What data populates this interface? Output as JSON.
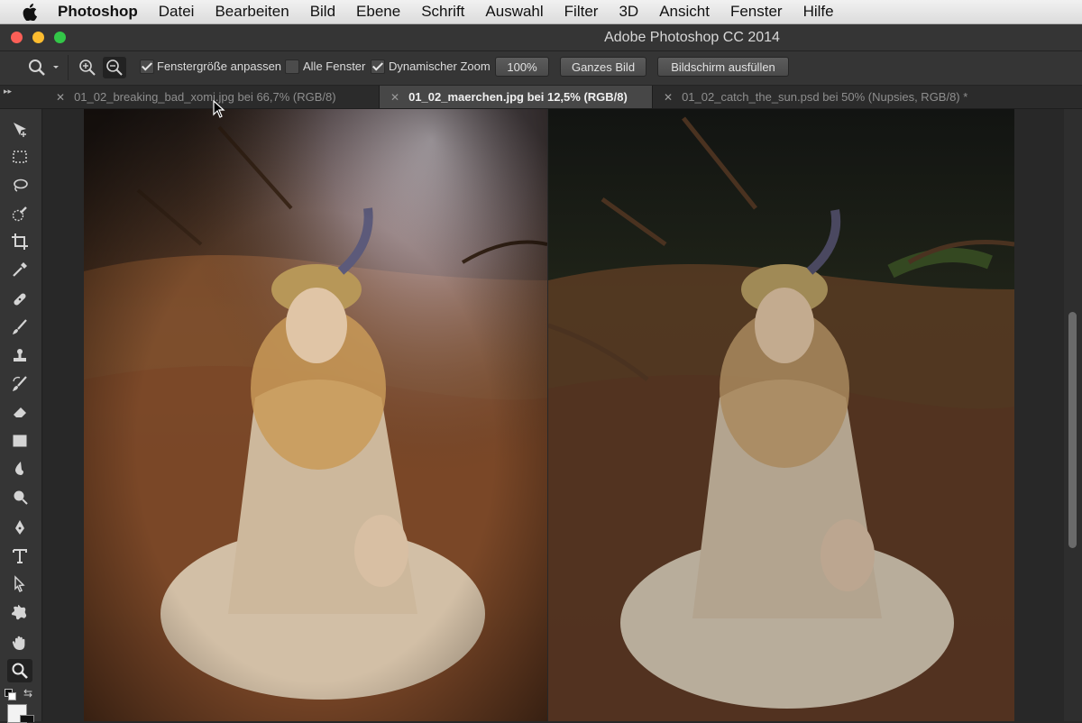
{
  "menubar": {
    "apple_icon": "apple-icon",
    "items": [
      "Photoshop",
      "Datei",
      "Bearbeiten",
      "Bild",
      "Ebene",
      "Schrift",
      "Auswahl",
      "Filter",
      "3D",
      "Ansicht",
      "Fenster",
      "Hilfe"
    ]
  },
  "window": {
    "title": "Adobe Photoshop CC 2014",
    "traffic_colors": [
      "#fc5f57",
      "#fdbc2f",
      "#33c748"
    ]
  },
  "options": {
    "fit_window": {
      "label": "Fenstergröße anpassen",
      "checked": true
    },
    "all_windows": {
      "label": "Alle Fenster",
      "checked": false
    },
    "scrubby_zoom": {
      "label": "Dynamischer Zoom",
      "checked": true
    },
    "btn_100": "100%",
    "btn_fit": "Ganzes Bild",
    "btn_fill": "Bildschirm ausfüllen"
  },
  "tabs": [
    {
      "label": "01_02_breaking_bad_xomi.jpg bei 66,7% (RGB/8)",
      "active": false
    },
    {
      "label": "01_02_maerchen.jpg bei 12,5% (RGB/8)",
      "active": true
    },
    {
      "label": "01_02_catch_the_sun.psd bei 50% (Nupsies, RGB/8) *",
      "active": false
    }
  ],
  "tools": [
    "move-tool-icon",
    "marquee-tool-icon",
    "lasso-tool-icon",
    "quick-selection-icon",
    "crop-tool-icon",
    "eyedropper-icon",
    "healing-brush-icon",
    "brush-tool-icon",
    "clone-stamp-icon",
    "history-brush-icon",
    "eraser-icon",
    "gradient-tool-icon",
    "blur-tool-icon",
    "dodge-tool-icon",
    "pen-tool-icon",
    "type-tool-icon",
    "path-selection-icon",
    "custom-shape-icon",
    "hand-tool-icon",
    "zoom-tool-icon"
  ],
  "colors": {
    "accent_selected_tab": "#474747",
    "chrome": "#353535"
  }
}
